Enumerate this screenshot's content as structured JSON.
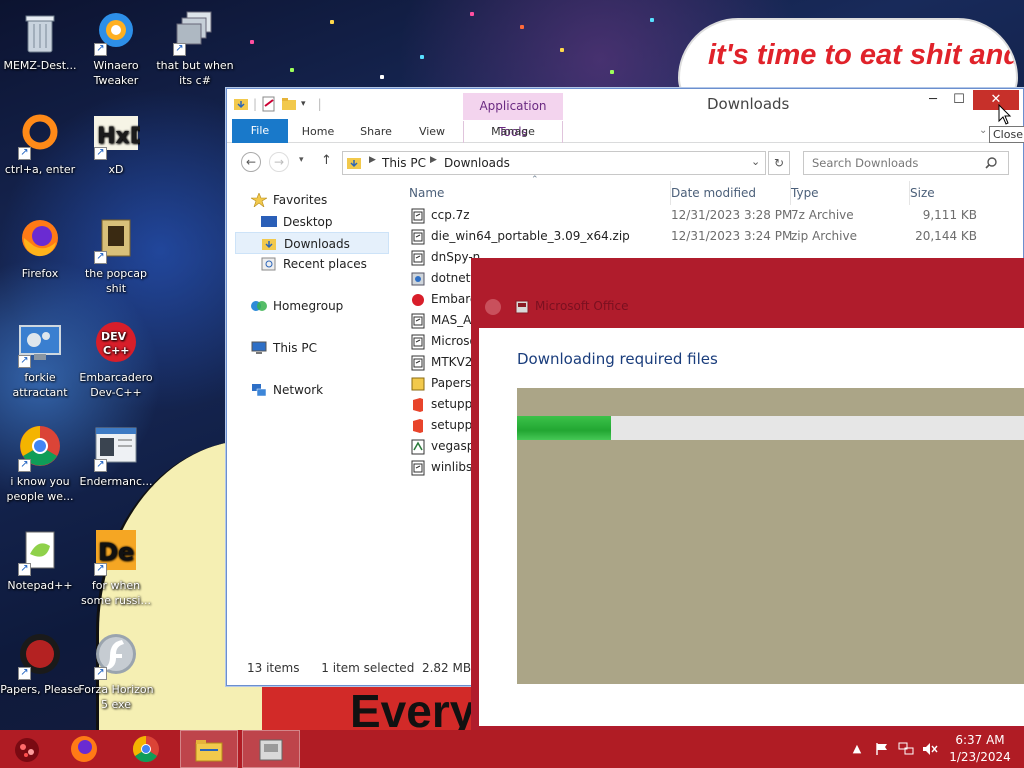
{
  "desktop": {
    "banner_text": "it's time to eat shit and die and celebrate",
    "sign_text": "Every",
    "icons": [
      {
        "label": "MEMZ-Dest...",
        "icon": "recycle-bin-icon"
      },
      {
        "label": "Winaero Tweaker",
        "icon": "winaero-icon"
      },
      {
        "label": "that but when its c#",
        "icon": "windows-stack-icon"
      },
      {
        "label": "ctrl+a, enter",
        "icon": "ring-icon"
      },
      {
        "label": "xD",
        "icon": "hxd-icon"
      },
      {
        "label": "Firefox",
        "icon": "firefox-icon"
      },
      {
        "label": "the popcap shit",
        "icon": "popcap-icon"
      },
      {
        "label": "forkie attractant",
        "icon": "monitor-gear-icon"
      },
      {
        "label": "Embarcadero Dev-C++",
        "icon": "devcpp-icon"
      },
      {
        "label": "i know you people we...",
        "icon": "chrome-icon"
      },
      {
        "label": "Endermanc...",
        "icon": "app-window-icon"
      },
      {
        "label": "Notepad++",
        "icon": "notepadpp-icon"
      },
      {
        "label": "for when some russi...",
        "icon": "die-icon"
      },
      {
        "label": "Papers, Please",
        "icon": "papers-please-icon"
      },
      {
        "label": "Forza Horizon 5 exe",
        "icon": "flash-icon"
      }
    ]
  },
  "explorer": {
    "title": "Downloads",
    "contextual_tab": "Application Tools",
    "tabs": [
      "File",
      "Home",
      "Share",
      "View",
      "Manage"
    ],
    "address": {
      "segments": [
        "This PC",
        "Downloads"
      ]
    },
    "search_placeholder": "Search Downloads",
    "nav": {
      "favorites": "Favorites",
      "desktop": "Desktop",
      "downloads": "Downloads",
      "recent": "Recent places",
      "homegroup": "Homegroup",
      "thispc": "This PC",
      "network": "Network"
    },
    "columns": [
      "Name",
      "Date modified",
      "Type",
      "Size"
    ],
    "files": [
      {
        "name": "ccp.7z",
        "date": "12/31/2023 3:28 PM",
        "type": "7z Archive",
        "size": "9,111 KB"
      },
      {
        "name": "die_win64_portable_3.09_x64.zip",
        "date": "12/31/2023 3:24 PM",
        "type": "zip Archive",
        "size": "20,144 KB"
      },
      {
        "name": "dnSpy-n",
        "date": "",
        "type": "",
        "size": ""
      },
      {
        "name": "dotnetfx",
        "date": "",
        "type": "",
        "size": ""
      },
      {
        "name": "Embarc",
        "date": "",
        "type": "",
        "size": ""
      },
      {
        "name": "MAS_AI",
        "date": "",
        "type": "",
        "size": ""
      },
      {
        "name": "Microso",
        "date": "",
        "type": "",
        "size": ""
      },
      {
        "name": "MTKV2",
        "date": "",
        "type": "",
        "size": ""
      },
      {
        "name": "PapersP",
        "date": "",
        "type": "",
        "size": ""
      },
      {
        "name": "setuppr",
        "date": "",
        "type": "",
        "size": ""
      },
      {
        "name": "setuppr",
        "date": "",
        "type": "",
        "size": ""
      },
      {
        "name": "vegaspr",
        "date": "",
        "type": "",
        "size": ""
      },
      {
        "name": "winlibs-",
        "date": "",
        "type": "",
        "size": ""
      }
    ],
    "status": {
      "count": "13 items",
      "selected": "1 item selected  2.82 MB"
    },
    "close_tooltip": "Close"
  },
  "dialog": {
    "title": "Microsoft Office",
    "heading": "Downloading required files",
    "progress": 0.185
  },
  "taskbar": {
    "time": "6:37 AM",
    "date": "1/23/2024"
  },
  "colors": {
    "taskbar": "#b01c24",
    "dialog_frame": "#b01c2c",
    "ribbon_file": "#1979ca",
    "progress_fill": "#22a632",
    "close_button": "#c7302a"
  }
}
